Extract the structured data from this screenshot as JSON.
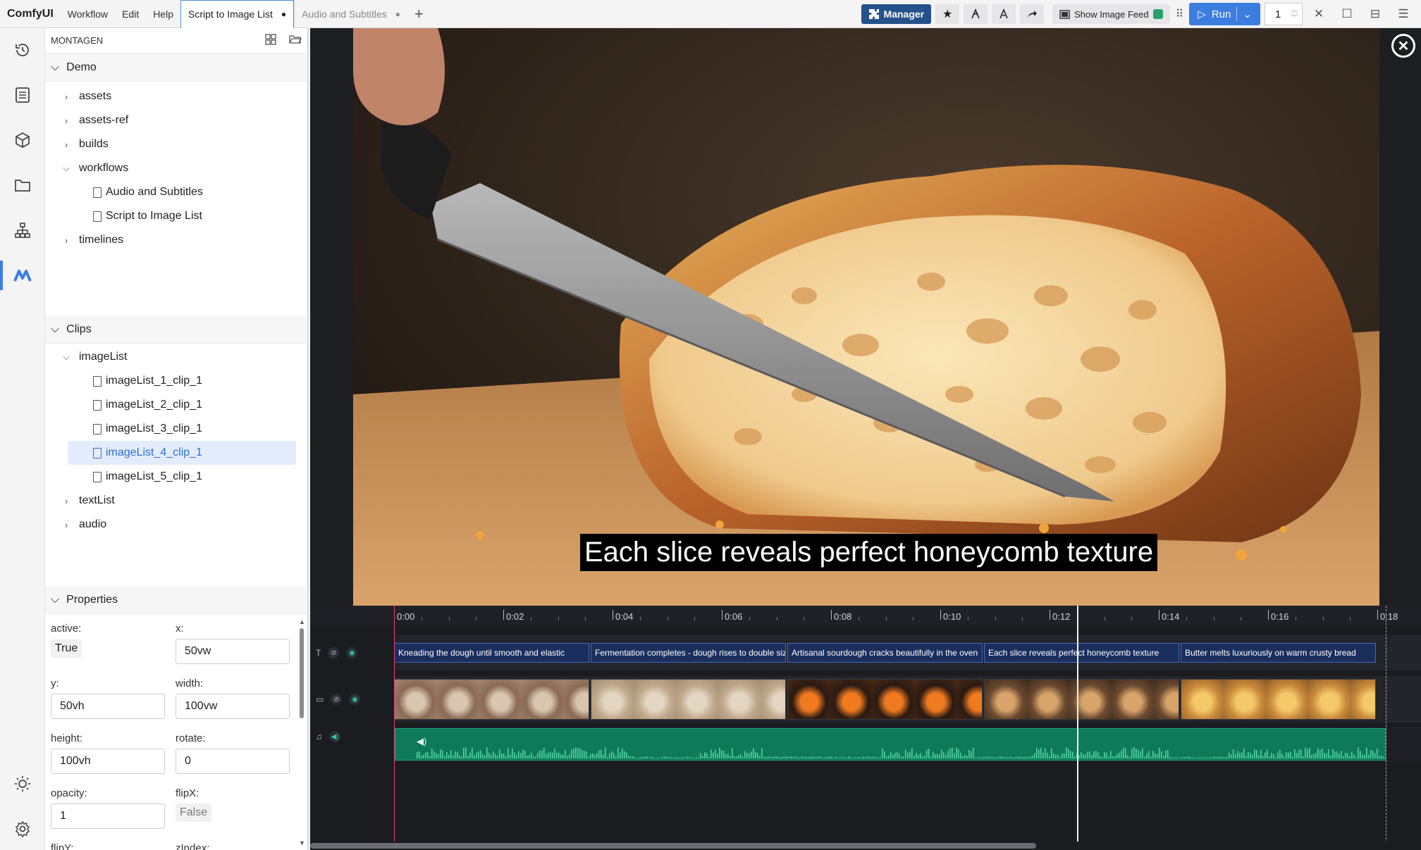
{
  "topbar": {
    "logo": "ComfyUI",
    "menu": [
      "Workflow",
      "Edit",
      "Help"
    ],
    "tabs": [
      {
        "label": "Script to Image List",
        "marker": "●"
      },
      {
        "label": "Audio and Subtitles",
        "marker": "●"
      }
    ],
    "new_tab": "+",
    "manager_label": "Manager",
    "show_feed_label": "Show Image Feed",
    "run_label": "Run",
    "batch_count": "1"
  },
  "sidebar": {
    "title": "MONTAGEN",
    "demo": {
      "label": "Demo",
      "items": [
        {
          "label": "assets",
          "type": "folder"
        },
        {
          "label": "assets-ref",
          "type": "folder"
        },
        {
          "label": "builds",
          "type": "folder"
        },
        {
          "label": "workflows",
          "type": "folder-open"
        },
        {
          "label": "Audio and Subtitles",
          "type": "file"
        },
        {
          "label": "Script to Image List",
          "type": "file"
        },
        {
          "label": "timelines",
          "type": "folder"
        }
      ]
    },
    "clips": {
      "label": "Clips",
      "items": [
        {
          "label": "imageList",
          "type": "folder-open"
        },
        {
          "label": "imageList_1_clip_1",
          "type": "file"
        },
        {
          "label": "imageList_2_clip_1",
          "type": "file"
        },
        {
          "label": "imageList_3_clip_1",
          "type": "file"
        },
        {
          "label": "imageList_4_clip_1",
          "type": "file",
          "selected": true
        },
        {
          "label": "imageList_5_clip_1",
          "type": "file"
        },
        {
          "label": "textList",
          "type": "folder"
        },
        {
          "label": "audio",
          "type": "folder"
        }
      ]
    },
    "properties": {
      "label": "Properties",
      "active_label": "active:",
      "active_value": "True",
      "x_label": "x:",
      "x_value": "50vw",
      "y_label": "y:",
      "y_value": "50vh",
      "width_label": "width:",
      "width_value": "100vw",
      "height_label": "height:",
      "height_value": "100vh",
      "rotate_label": "rotate:",
      "rotate_value": "0",
      "opacity_label": "opacity:",
      "opacity_value": "1",
      "flipx_label": "flipX:",
      "flipx_value": "False",
      "flipy_label": "flipY:",
      "zindex_label": "zIndex:"
    }
  },
  "preview": {
    "subtitle": "Each slice reveals perfect honeycomb texture"
  },
  "timeline": {
    "ticks": [
      "0:00",
      "0:02",
      "0:04",
      "0:06",
      "0:08",
      "0:10",
      "0:12",
      "0:14",
      "0:16",
      "0:18"
    ],
    "text_clips": [
      "Kneading the dough until smooth and elastic",
      "Fermentation completes - dough rises to double size",
      "Artisanal sourdough cracks beautifully in the oven",
      "Each slice reveals perfect honeycomb texture",
      "Butter melts luxuriously on warm crusty bread"
    ],
    "total_seconds": 18,
    "playhead_seconds": 12.5
  },
  "colors": {
    "accent": "#3b7ee0",
    "manager": "#24518a",
    "audio_clip": "#0f7a57",
    "text_clip": "#1b2f5e",
    "playhead_start": "#e83f75"
  }
}
